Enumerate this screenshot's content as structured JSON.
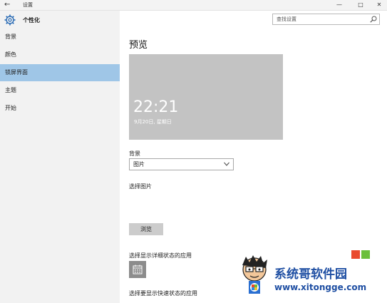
{
  "window": {
    "back_glyph": "←",
    "title": "设置",
    "controls": {
      "minimize": "—",
      "maximize": "□",
      "close": "✕"
    }
  },
  "sidebar": {
    "header": "个性化",
    "header_icon": "gear-icon",
    "items": [
      {
        "label": "背景",
        "active": false
      },
      {
        "label": "颜色",
        "active": false
      },
      {
        "label": "锁屏界面",
        "active": true
      },
      {
        "label": "主题",
        "active": false
      },
      {
        "label": "开始",
        "active": false
      }
    ],
    "active_color": "#9fc6e7"
  },
  "search": {
    "placeholder": "查找设置",
    "icon": "search-icon"
  },
  "main": {
    "title": "预览",
    "preview": {
      "time": "22:21",
      "date": "9月20日, 星期日",
      "background": "#c3c3c3"
    },
    "background_label": "背景",
    "background_value": "图片",
    "choose_picture_label": "选择图片",
    "browse_label": "浏览",
    "detailed_status_label": "选择显示详细状态的应用",
    "detailed_status_icon": "calendar-icon",
    "quick_status_label": "选择要显示快速状态的应用"
  },
  "watermark": {
    "title": "系统哥软件园",
    "url": "www.xitongge.com",
    "color": "#1f4fa3"
  }
}
